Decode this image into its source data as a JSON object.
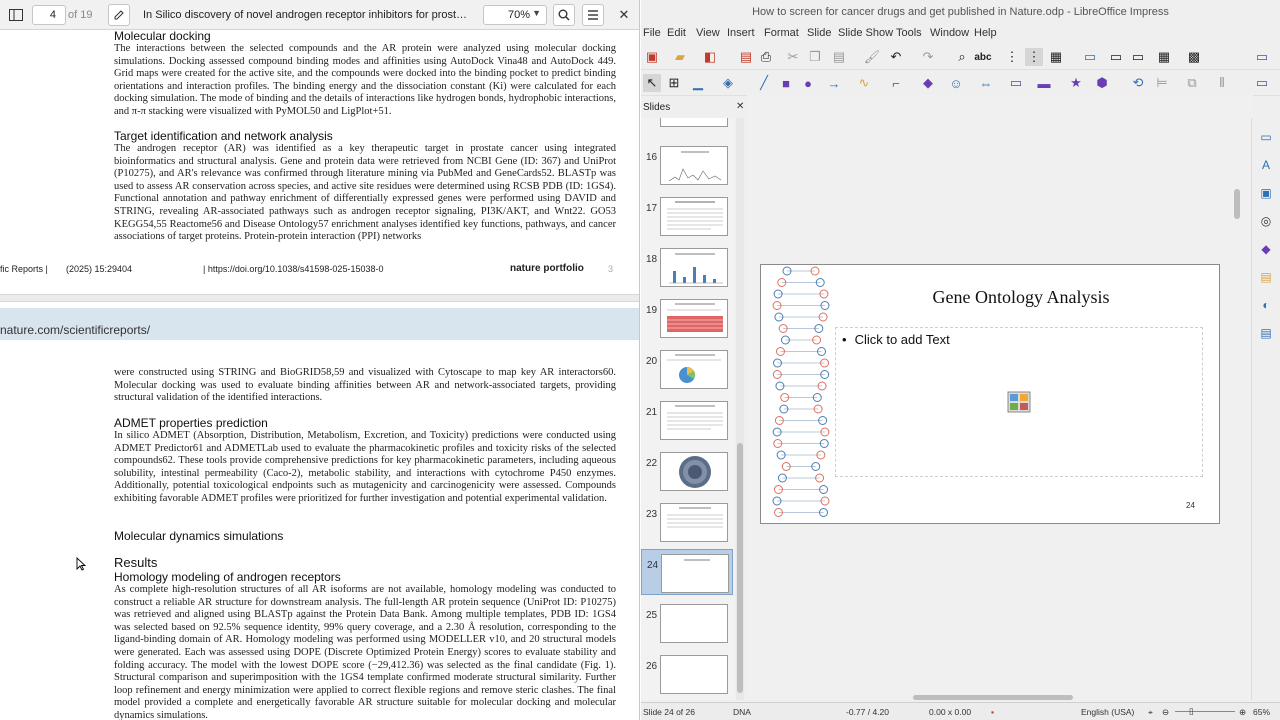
{
  "pdf_viewer": {
    "page_current": "4",
    "page_total": "of 19",
    "doc_title": "In Silico discovery of novel androgen receptor inhibitors for prost…",
    "zoom": "70%",
    "url_bar": "nature.com/scientificreports/",
    "footer": {
      "journal": "fic Reports |",
      "citation": "(2025) 15:29404",
      "doi": "| https://doi.org/10.1038/s41598-025-15038-0",
      "publisher": "nature portfolio",
      "page": "3"
    },
    "page1": {
      "h_docking": "Molecular docking",
      "p_docking": "The interactions between the selected compounds and the AR protein were analyzed using molecular docking simulations. Docking assessed compound binding modes and affinities using AutoDock Vina48 and AutoDock 449. Grid maps were created for the active site, and the compounds were docked into the binding pocket to predict binding orientations and interaction profiles. The binding energy and the dissociation constant (Ki) were calculated for each docking simulation. The mode of binding and the details of interactions like hydrogen bonds, hydrophobic interactions, and π-π stacking were visualized with PyMOL50 and LigPlot+51.",
      "h_target": "Target identification and network analysis",
      "p_target": "The androgen receptor (AR) was identified as a key therapeutic target in prostate cancer using integrated bioinformatics and structural analysis. Gene and protein data were retrieved from NCBI Gene (ID: 367) and UniProt (P10275), and AR's relevance was confirmed through literature mining via PubMed and GeneCards52. BLASTp was used to assess AR conservation across species, and active site residues were determined using RCSB PDB (ID: 1GS4). Functional annotation and pathway enrichment of differentially expressed genes were performed using DAVID and STRING, revealing AR-associated pathways such as androgen receptor signaling, PI3K/AKT, and Wnt22. GO53 KEGG54,55 Reactome56 and Disease Ontology57 enrichment analyses identified key functions, pathways, and cancer associations of target proteins. Protein-protein interaction (PPI) networks"
    },
    "page2": {
      "p_cont": "were constructed using STRING and BioGRID58,59 and visualized with Cytoscape to map key AR interactors60. Molecular docking was used to evaluate binding affinities between AR and network-associated targets, providing structural validation of the identified interactions.",
      "h_admet": "ADMET properties prediction",
      "p_admet": "In silico ADMET (Absorption, Distribution, Metabolism, Excretion, and Toxicity) predictions were conducted using ADMET Predictor61 and ADMETLab used to evaluate the pharmacokinetic profiles and toxicity risks of the selected compounds62. These tools provide comprehensive predictions for key pharmacokinetic parameters, including aqueous solubility, intestinal permeability (Caco-2), metabolic stability, and interactions with cytochrome P450 enzymes. Additionally, potential toxicological endpoints such as mutagenicity and carcinogenicity were assessed. Compounds exhibiting favorable ADMET profiles were prioritized for further investigation and potential experimental validation.",
      "h_md": "Molecular dynamics simulations",
      "h_results": "Results",
      "h_homology": "Homology modeling of androgen receptors",
      "p_homology": "As complete high-resolution structures of all AR isoforms are not available, homology modeling was conducted to construct a reliable AR structure for downstream analysis. The full-length AR protein sequence (UniProt ID: P10275) was retrieved and aligned using BLASTp against the Protein Data Bank. Among multiple templates, PDB ID: 1GS4 was selected based on 92.5% sequence identity, 99% query coverage, and a 2.30 Å resolution, corresponding to the ligand-binding domain of AR. Homology modeling was performed using MODELLER v10, and 20 structural models were generated. Each was assessed using DOPE (Discrete Optimized Protein Energy) scores to evaluate stability and folding accuracy. The model with the lowest DOPE score (−29,412.36) was selected as the final candidate (Fig. 1). Structural comparison and superimposition with the 1GS4 template confirmed moderate structural similarity. Further loop refinement and energy minimization were applied to correct flexible regions and remove steric clashes. The final model provided a complete and energetically favorable AR structure suitable for molecular docking and molecular dynamics simulations."
    }
  },
  "impress": {
    "window_title": "How to screen for cancer drugs and get published in Nature.odp - LibreOffice Impress",
    "menu": [
      "File",
      "Edit",
      "View",
      "Insert",
      "Format",
      "Slide",
      "Slide Show",
      "Tools",
      "Window",
      "Help"
    ],
    "slides_panel_title": "Slides",
    "slide_numbers": [
      "16",
      "17",
      "18",
      "19",
      "20",
      "21",
      "22",
      "23",
      "24",
      "25",
      "26"
    ],
    "active_slide": "24",
    "slide": {
      "title": "Gene Ontology Analysis",
      "placeholder": "Click to add Text",
      "number": "24"
    },
    "status": {
      "slide_info": "Slide 24 of 26",
      "layout": "DNA",
      "position": "-0.77 / 4.20",
      "size": "0.00 x 0.00",
      "language": "English (USA)",
      "zoom": "65%"
    },
    "colors": {
      "accent": "#b8cde6",
      "dna_blue": "#4a7fb5",
      "dna_red": "#e07060"
    }
  }
}
